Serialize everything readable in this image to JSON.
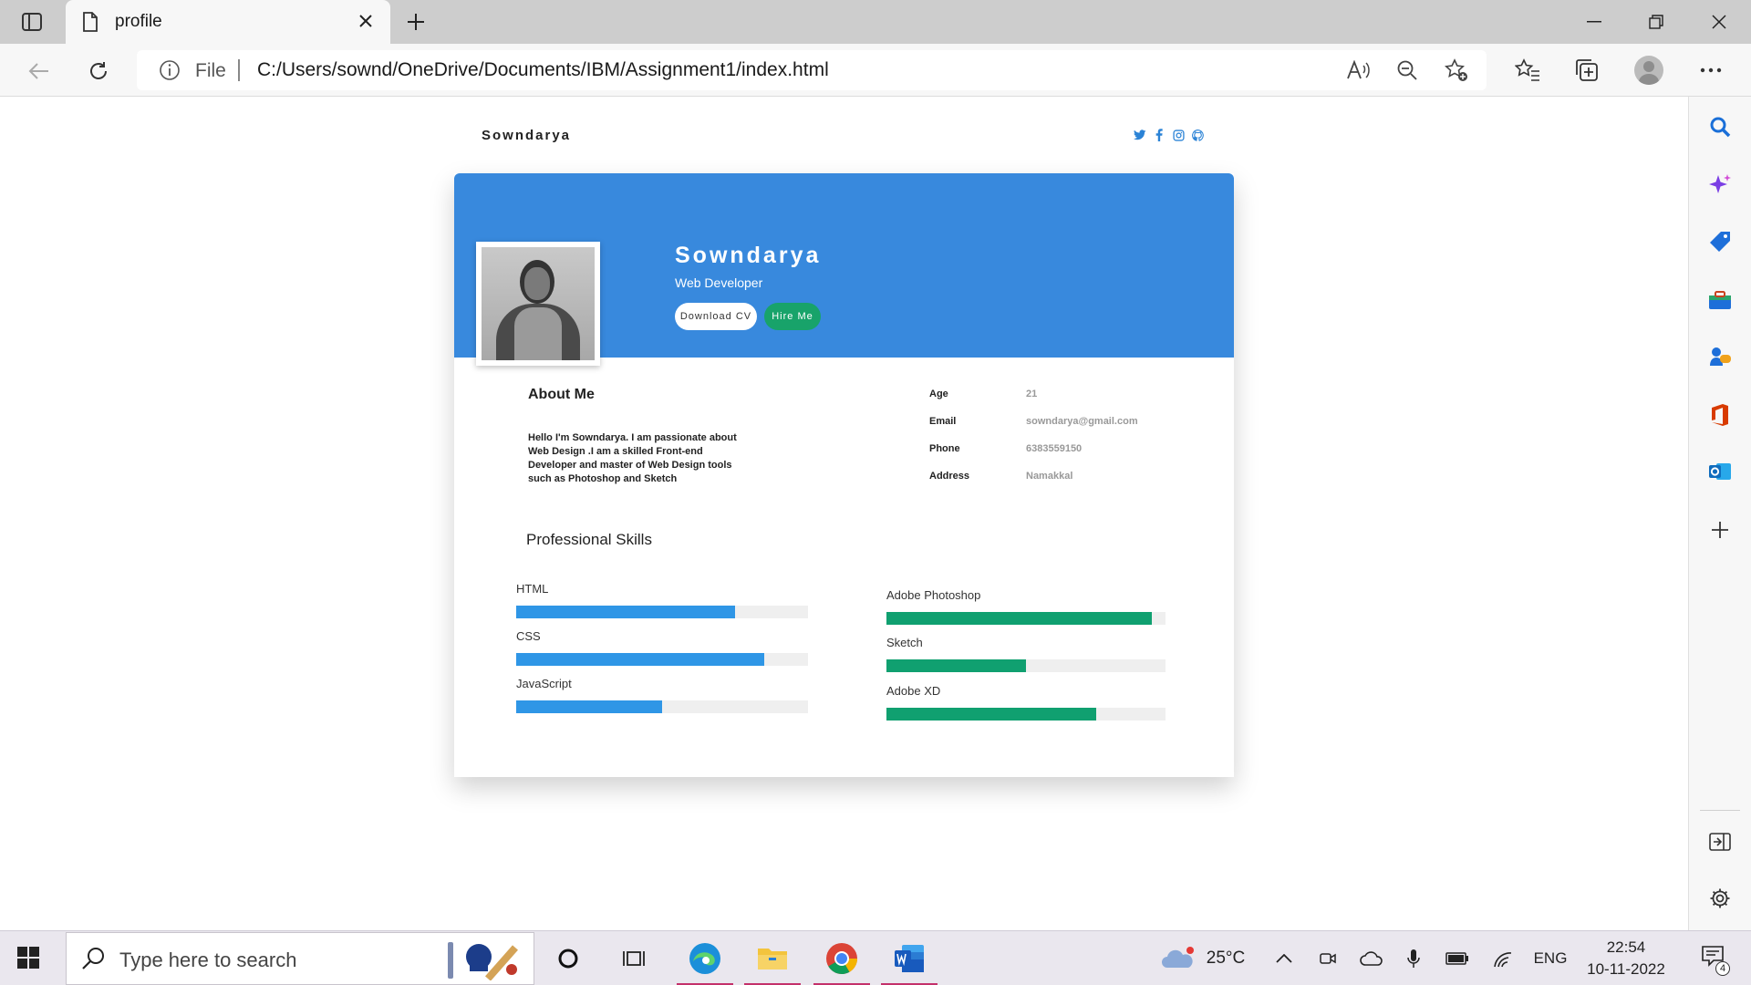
{
  "browser": {
    "tab_title": "profile",
    "file_label": "File",
    "url": "C:/Users/sownd/OneDrive/Documents/IBM/Assignment1/index.html"
  },
  "site": {
    "brand": "Sowndarya",
    "social_icons": [
      "twitter-icon",
      "facebook-icon",
      "instagram-icon",
      "github-icon"
    ]
  },
  "profile": {
    "name": "Sowndarya",
    "role": "Web Developer",
    "download_cv_label": "Download CV",
    "hire_me_label": "Hire Me",
    "accent_blue": "#3889dd",
    "accent_green": "#18a36a"
  },
  "about": {
    "title": "About Me",
    "text": "Hello I'm Sowndarya. I am passionate about Web Design .I am a skilled Front-end Developer and master of Web Design tools such as Photoshop and Sketch"
  },
  "details": [
    {
      "key": "Age",
      "value": "21"
    },
    {
      "key": "Email",
      "value": "sowndarya@gmail.com"
    },
    {
      "key": "Phone",
      "value": "6383559150"
    },
    {
      "key": "Address",
      "value": "Namakkal"
    }
  ],
  "skills": {
    "title": "Professional Skills",
    "left": [
      {
        "name": "HTML",
        "level": 0.75
      },
      {
        "name": "CSS",
        "level": 0.85
      },
      {
        "name": "JavaScript",
        "level": 0.5
      }
    ],
    "right": [
      {
        "name": "Adobe Photoshop",
        "level": 0.95
      },
      {
        "name": "Sketch",
        "level": 0.5
      },
      {
        "name": "Adobe XD",
        "level": 0.75
      }
    ]
  },
  "taskbar": {
    "search_placeholder": "Type here to search",
    "weather": "25°C",
    "language": "ENG",
    "time": "22:54",
    "date": "10-11-2022",
    "notification_count": "4"
  }
}
